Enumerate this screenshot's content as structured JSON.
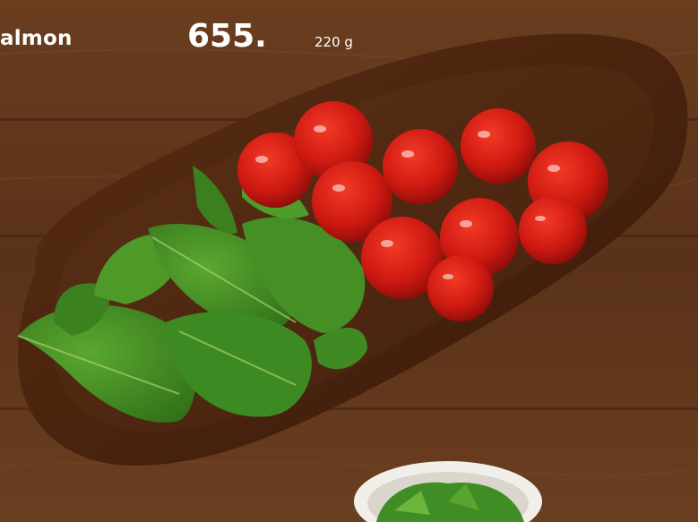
{
  "dish": {
    "name": "almon",
    "price": "655.",
    "weight": "220 g"
  },
  "colors": {
    "table": "#5a3219",
    "board": "#4a2410",
    "tomato": "#d41c14",
    "basil": "#3e8a22",
    "text": "#ffffff"
  }
}
